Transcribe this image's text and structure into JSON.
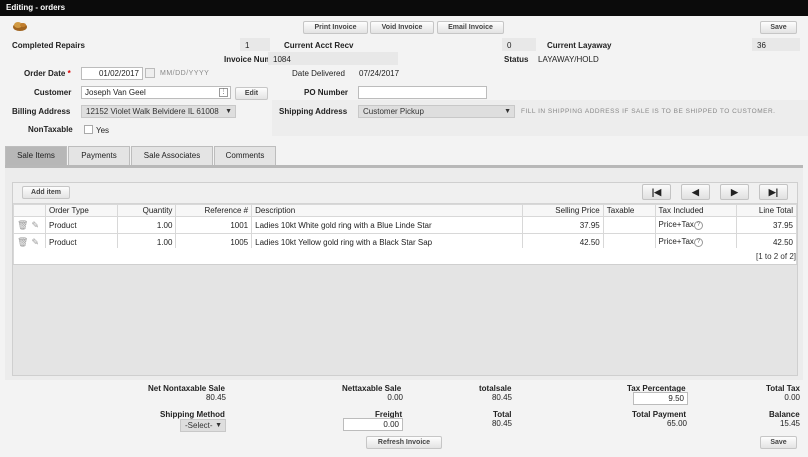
{
  "window": {
    "title": "Editing - orders"
  },
  "toolbar": {
    "print_label": "Print Invoice",
    "void_label": "Void Invoice",
    "email_label": "Email Invoice",
    "save_label": "Save"
  },
  "summary": {
    "completed_repairs_label": "Completed Repairs",
    "completed_repairs_value": "1",
    "current_acct_recv_label": "Current Acct Recv",
    "current_acct_recv_value": "0",
    "current_layaway_label": "Current Layaway",
    "current_layaway_value": "36"
  },
  "invoice": {
    "number_label": "Invoice Number",
    "number_value": "1084",
    "status_label": "Status",
    "status_value": "LAYAWAY/HOLD"
  },
  "order": {
    "order_date_label": "Order Date",
    "order_date_value": "01/02/2017",
    "date_format": "MM/DD/YYYY",
    "date_delivered_label": "Date Delivered",
    "date_delivered_value": "07/24/2017",
    "customer_label": "Customer",
    "customer_value": "Joseph Van Geel",
    "edit_label": "Edit",
    "po_number_label": "PO Number",
    "po_number_value": "",
    "billing_address_label": "Billing Address",
    "billing_address_value": "12152 Violet Walk Belvidere IL 61008",
    "shipping_address_label": "Shipping Address",
    "shipping_address_value": "Customer Pickup",
    "shipping_hint": "FILL IN SHIPPING ADDRESS IF SALE IS TO BE SHIPPED TO CUSTOMER.",
    "nontaxable_label": "NonTaxable",
    "nontaxable_yes_label": "Yes"
  },
  "tabs": [
    {
      "label": "Sale Items"
    },
    {
      "label": "Payments"
    },
    {
      "label": "Sale Associates"
    },
    {
      "label": "Comments"
    }
  ],
  "grid": {
    "add_item_label": "Add item",
    "nav": {
      "first": "|◀",
      "prev": "◀",
      "next": "▶",
      "last": "▶|"
    },
    "columns": [
      "Order Type",
      "Quantity",
      "Reference #",
      "Description",
      "Selling Price",
      "Taxable",
      "Tax Included",
      "Line Total"
    ],
    "rows": [
      {
        "order_type": "Product",
        "quantity": "1.00",
        "reference": "1001",
        "description": "Ladies 10kt White gold ring with a Blue Linde Star",
        "selling_price": "37.95",
        "taxable": "",
        "tax_included": "Price+Tax",
        "line_total": "37.95"
      },
      {
        "order_type": "Product",
        "quantity": "1.00",
        "reference": "1005",
        "description": "Ladies 10kt Yellow gold ring with a Black Star Sap",
        "selling_price": "42.50",
        "taxable": "",
        "tax_included": "Price+Tax",
        "line_total": "42.50"
      }
    ],
    "pager": "[1 to 2 of 2]"
  },
  "totals": {
    "net_nontaxable_label": "Net Nontaxable Sale",
    "net_nontaxable_value": "80.45",
    "nettaxable_label": "Nettaxable Sale",
    "nettaxable_value": "0.00",
    "totalsale_label": "totalsale",
    "totalsale_value": "80.45",
    "tax_percentage_label": "Tax Percentage",
    "tax_percentage_value": "9.50",
    "total_tax_label": "Total Tax",
    "total_tax_value": "0.00",
    "shipping_method_label": "Shipping Method",
    "shipping_method_value": "-Select-",
    "freight_label": "Freight",
    "freight_value": "0.00",
    "total_label": "Total",
    "total_value": "80.45",
    "total_payment_label": "Total Payment",
    "total_payment_value": "65.00",
    "balance_label": "Balance",
    "balance_value": "15.45",
    "refresh_label": "Refresh Invoice",
    "save_label": "Save"
  }
}
